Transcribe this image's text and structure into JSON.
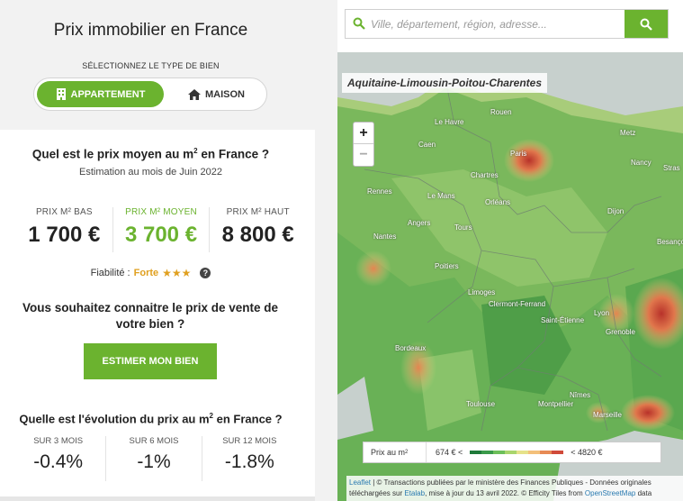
{
  "header": {
    "title": "Prix immobilier en France",
    "type_label": "SÉLECTIONNEZ LE TYPE DE BIEN",
    "toggle": {
      "appartement": "APPARTEMENT",
      "maison": "MAISON",
      "selected": "APPARTEMENT"
    }
  },
  "price_section": {
    "question": "Quel est le prix moyen au m",
    "question_sup": "2",
    "question_end": " en France ?",
    "estimate_date": "Estimation au mois de Juin 2022",
    "low": {
      "label": "PRIX M² BAS",
      "value": "1 700 €"
    },
    "mid": {
      "label": "PRIX M² MOYEN",
      "value": "3 700 €"
    },
    "high": {
      "label": "PRIX M² HAUT",
      "value": "8 800 €"
    },
    "reliability_label": "Fiabilité :",
    "reliability_value": "Forte",
    "reliability_stars": "★★★",
    "help": "?"
  },
  "estimate_section": {
    "question": "Vous souhaitez connaitre le prix de vente de votre bien ?",
    "button": "ESTIMER MON BIEN"
  },
  "evolution_section": {
    "question": "Quelle est l'évolution du prix au m",
    "question_sup": "2",
    "question_end": " en France ?",
    "periods": [
      {
        "label": "SUR 3 MOIS",
        "value": "-0.4%"
      },
      {
        "label": "SUR 6 MOIS",
        "value": "-1%"
      },
      {
        "label": "SUR 12 MOIS",
        "value": "-1.8%"
      }
    ]
  },
  "search": {
    "placeholder": "Ville, département, région, adresse..."
  },
  "map": {
    "region_label": "Aquitaine-Limousin-Poitou-Charentes",
    "zoom_in": "+",
    "zoom_out": "−",
    "cities": [
      "Le Havre",
      "Rouen",
      "Caen",
      "Paris",
      "Metz",
      "Nancy",
      "Stras",
      "Chartres",
      "Rennes",
      "Le Mans",
      "Orléans",
      "Angers",
      "Tours",
      "Dijon",
      "Besançon",
      "Nantes",
      "Poitiers",
      "Limoges",
      "Clermont-Ferrand",
      "Lyon",
      "Saint-Étienne",
      "Grenoble",
      "Bordeaux",
      "Toulouse",
      "Montpellier",
      "Nîmes",
      "Marseille"
    ],
    "legend": {
      "title": "Prix au m",
      "title_sup": "2",
      "min": "674 € <",
      "max": "< 4820 €"
    },
    "legend_colors": [
      "#1f7a3a",
      "#3a9a4a",
      "#6cbf5a",
      "#a9d56c",
      "#e6e28a",
      "#f3c07a",
      "#e78a55",
      "#d04a3a"
    ],
    "attribution": {
      "leaflet": "Leaflet",
      "text1": " | © Transactions publiées par le ministère des Finances Publiques - Données originales téléchargées sur ",
      "etalab": "Etalab",
      "text2": ", mise à jour du 13 avril 2022. © Efficity Tiles from ",
      "osm": "OpenStreetMap",
      "text3": " data"
    }
  },
  "colors": {
    "accent": "#6bb32f",
    "stars": "#e0a020"
  }
}
